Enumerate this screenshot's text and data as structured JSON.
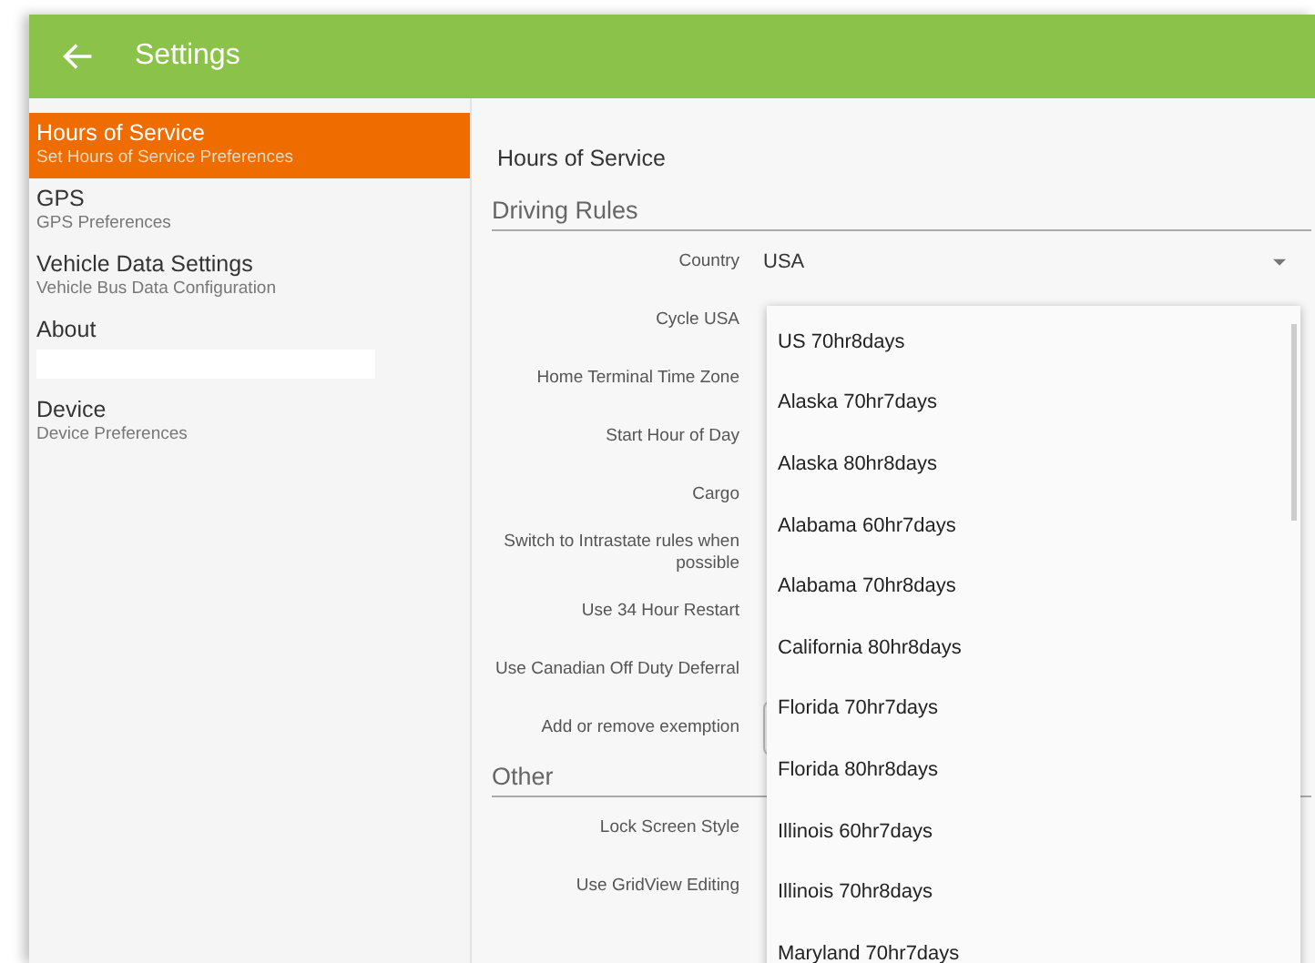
{
  "app_bar": {
    "title": "Settings"
  },
  "sidebar": {
    "items": [
      {
        "title": "Hours of Service",
        "subtitle": "Set Hours of Service Preferences",
        "selected": true,
        "redacted": false
      },
      {
        "title": "GPS",
        "subtitle": "GPS Preferences",
        "selected": false,
        "redacted": false
      },
      {
        "title": "Vehicle Data Settings",
        "subtitle": "Vehicle Bus Data Configuration",
        "selected": false,
        "redacted": false
      },
      {
        "title": "About",
        "selected": false,
        "redacted": true
      },
      {
        "title": "Device",
        "subtitle": "Device Preferences",
        "selected": false,
        "redacted": false
      }
    ]
  },
  "content": {
    "title": "Hours of Service",
    "sections": [
      {
        "title": "Driving Rules",
        "rows": [
          {
            "label": "Country",
            "kind": "select",
            "value": "USA"
          },
          {
            "label": "Cycle USA",
            "kind": "label"
          },
          {
            "label": "Home Terminal Time Zone",
            "kind": "label"
          },
          {
            "label": "Start Hour of Day",
            "kind": "label"
          },
          {
            "label": "Cargo",
            "kind": "label"
          },
          {
            "label": "Switch to Intrastate rules when possible",
            "kind": "label"
          },
          {
            "label": "Use 34 Hour Restart",
            "kind": "label"
          },
          {
            "label": "Use Canadian Off Duty Deferral",
            "kind": "label"
          },
          {
            "label": "Add or remove exemption",
            "kind": "button"
          }
        ]
      },
      {
        "title": "Other",
        "rows": [
          {
            "label": "Lock Screen Style",
            "kind": "label"
          },
          {
            "label": "Use GridView Editing",
            "kind": "label"
          }
        ]
      }
    ]
  },
  "dropdown": {
    "options": [
      {
        "label": "US 70hr8days",
        "selected": false
      },
      {
        "label": "Alaska 70hr7days",
        "selected": false
      },
      {
        "label": "Alaska 80hr8days",
        "selected": false
      },
      {
        "label": "Alabama 60hr7days",
        "selected": false
      },
      {
        "label": "Alabama 70hr8days",
        "selected": false
      },
      {
        "label": "California 80hr8days",
        "selected": false
      },
      {
        "label": "Florida 70hr7days",
        "selected": false
      },
      {
        "label": "Florida 80hr8days",
        "selected": false
      },
      {
        "label": "Illinois 60hr7days",
        "selected": false
      },
      {
        "label": "Illinois 70hr8days",
        "selected": false
      },
      {
        "label": "Maryland 70hr7days",
        "selected": false
      }
    ]
  }
}
